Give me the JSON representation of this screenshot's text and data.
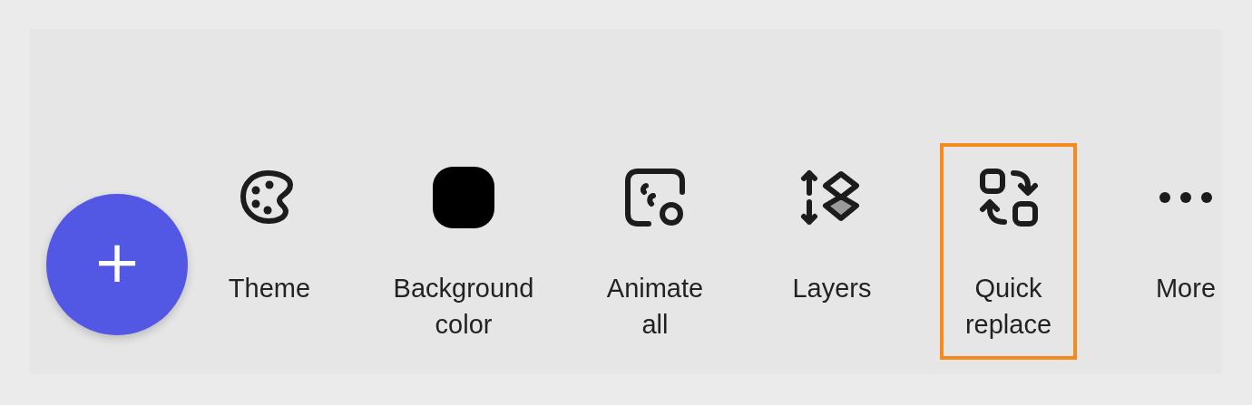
{
  "add_button": {
    "label": "+"
  },
  "toolbar": {
    "items": [
      {
        "kind": "theme",
        "label": "Theme",
        "highlighted": false
      },
      {
        "kind": "background_color",
        "label": "Background color",
        "highlighted": false
      },
      {
        "kind": "animate",
        "label": "Animate all",
        "highlighted": false
      },
      {
        "kind": "layers",
        "label": "Layers",
        "highlighted": false
      },
      {
        "kind": "replace",
        "label": "Quick replace",
        "highlighted": true
      },
      {
        "kind": "more",
        "label": "More",
        "highlighted": false
      }
    ]
  }
}
